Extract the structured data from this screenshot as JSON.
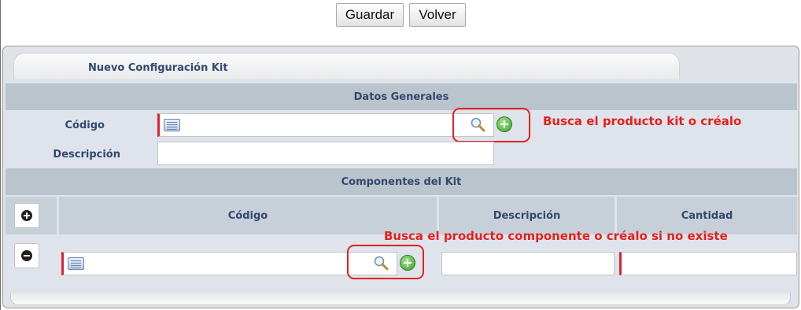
{
  "toolbar": {
    "guardar_label": "Guardar",
    "volver_label": "Volver"
  },
  "panel": {
    "title": "Nuevo Configuración Kit"
  },
  "datos_generales": {
    "heading": "Datos Generales",
    "codigo_label": "Código",
    "codigo_value": "",
    "descripcion_label": "Descripción",
    "descripcion_value": ""
  },
  "componentes": {
    "heading": "Componentes del Kit",
    "columns": [
      "Código",
      "Descripción",
      "Cantidad"
    ],
    "rows": [
      {
        "codigo": "",
        "descripcion": "",
        "cantidad": ""
      }
    ]
  },
  "annotations": {
    "kit_note": "Busca el producto kit o créalo",
    "component_note": "Busca el producto componente o créalo si no existe"
  },
  "icons": {
    "list": "list-icon",
    "search": "search-icon",
    "add": "add-icon",
    "add_row": "plus-circle-icon",
    "remove_row": "minus-circle-icon"
  },
  "colors": {
    "accent_text": "#34486e",
    "section_header": "#b9c4cc",
    "annotation_red": "#e5211d",
    "required_marker": "#d6272e"
  }
}
